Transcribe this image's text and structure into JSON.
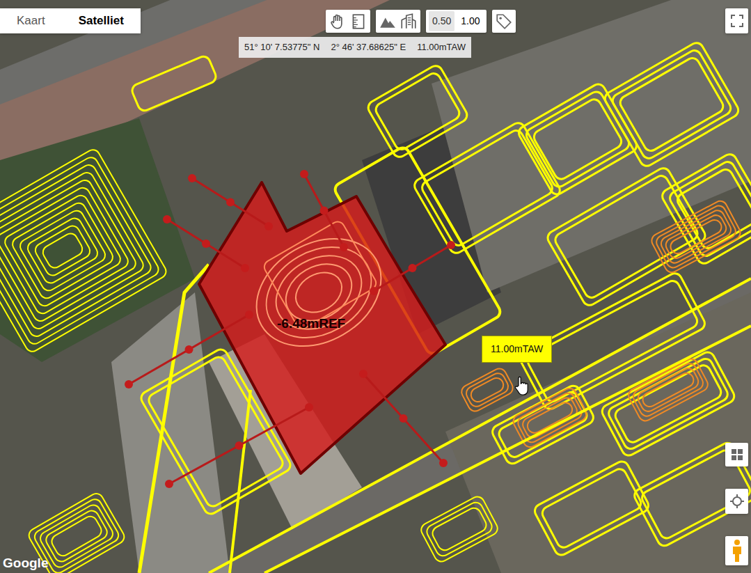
{
  "map_type_tabs": [
    {
      "label": "Kaart",
      "selected": false
    },
    {
      "label": "Satelliet",
      "selected": true
    }
  ],
  "scale_buttons": [
    {
      "label": "0.50",
      "selected": false
    },
    {
      "label": "1.00",
      "selected": true
    }
  ],
  "readout": {
    "latitude": "51° 10' 7.53775\" N",
    "longitude": "2° 46' 37.68625\" E",
    "height": "11.00mTAW"
  },
  "building": {
    "label": "-6.48mREF"
  },
  "tooltip": {
    "text": "11.00mTAW"
  },
  "attribution": "Google"
}
